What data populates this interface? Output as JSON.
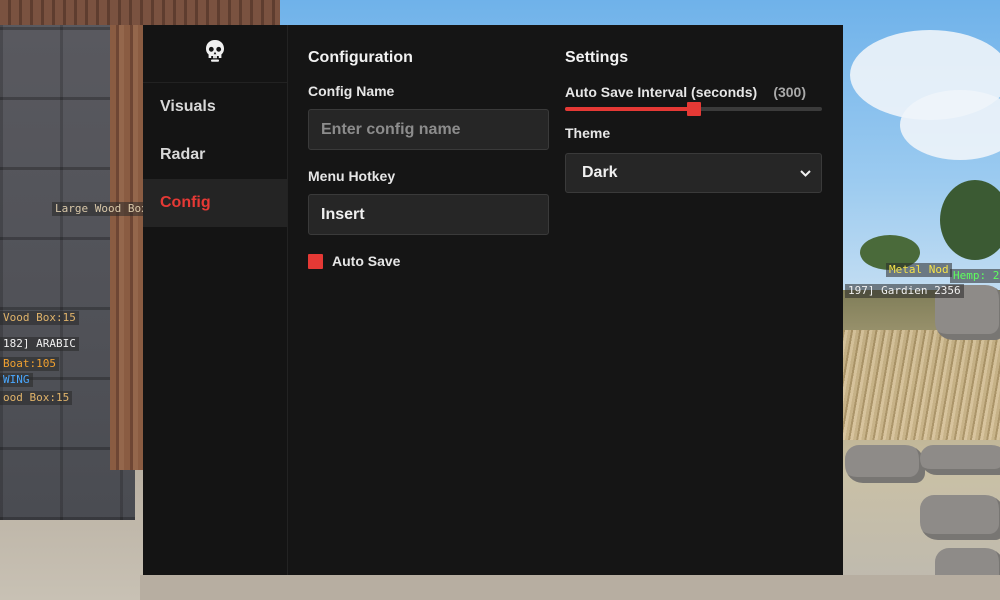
{
  "app": {
    "accent_color": "#e53935",
    "logo_icon": "skull-icon"
  },
  "sidebar": {
    "items": [
      {
        "label": "Visuals",
        "active": false
      },
      {
        "label": "Radar",
        "active": false
      },
      {
        "label": "Config",
        "active": true,
        "color": "#e53935"
      }
    ]
  },
  "configuration": {
    "title": "Configuration",
    "config_name_label": "Config Name",
    "config_name_placeholder": "Enter config name",
    "config_name_value": "",
    "menu_hotkey_label": "Menu Hotkey",
    "menu_hotkey_value": "Insert",
    "auto_save_label": "Auto Save",
    "auto_save_checked": true
  },
  "settings": {
    "title": "Settings",
    "auto_save_interval_label": "Auto Save Interval (seconds)",
    "auto_save_interval_value": "(300)",
    "auto_save_interval_fraction": 0.5,
    "theme_label": "Theme",
    "theme_selected": "Dark"
  },
  "esp_overlay": {
    "left": [
      {
        "text": "Large Wood Box",
        "color": "#d8c7a8"
      },
      {
        "text": "Vood Box:15",
        "color": "#e0b36a"
      },
      {
        "text": "182] ARABIC",
        "color": "#f0f0f0"
      },
      {
        "text": "Boat:105",
        "color": "#f0a030"
      },
      {
        "text": "WING",
        "color": "#4aa8ff"
      },
      {
        "text": "ood Box:15",
        "color": "#e0b36a"
      }
    ],
    "right": [
      {
        "text": "Metal Nod",
        "color": "#f4e24a"
      },
      {
        "text": "Hemp: 2",
        "color": "#5dff5d"
      },
      {
        "text": "197] Gardien 2356",
        "color": "#f0f0f0"
      }
    ]
  }
}
